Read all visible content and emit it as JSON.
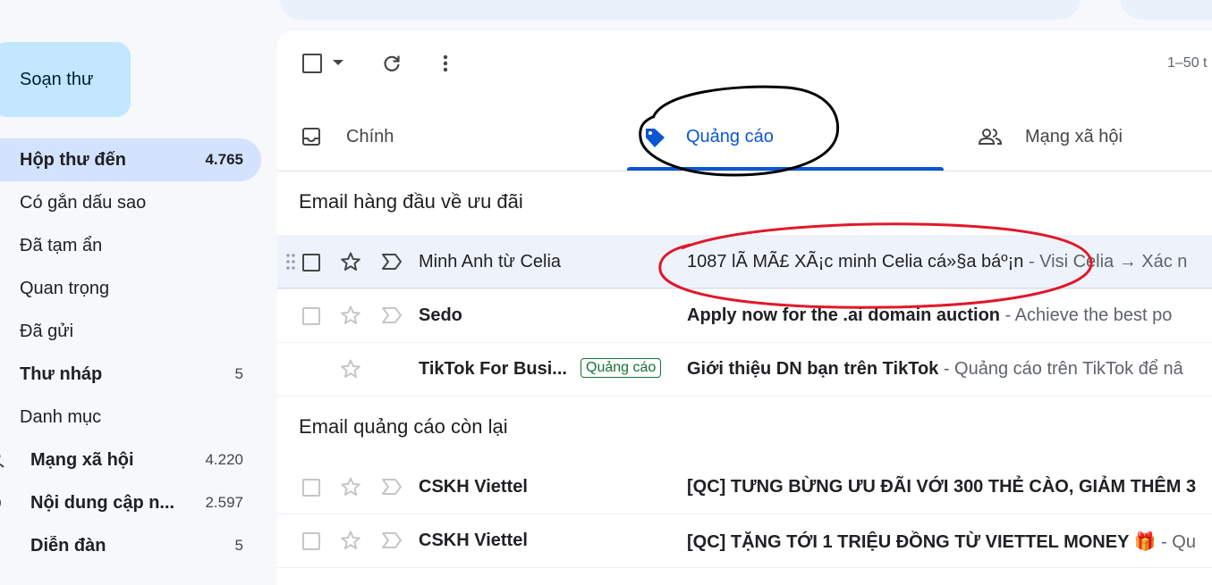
{
  "sidebar": {
    "compose_label": "Soạn thư",
    "items": [
      {
        "label": "Hộp thư đến",
        "count": "4.765"
      },
      {
        "label": "Có gắn dấu sao",
        "count": ""
      },
      {
        "label": "Đã tạm ẩn",
        "count": ""
      },
      {
        "label": "Quan trọng",
        "count": ""
      },
      {
        "label": "Đã gửi",
        "count": ""
      },
      {
        "label": "Thư nháp",
        "count": "5"
      },
      {
        "label": "Danh mục",
        "count": ""
      },
      {
        "label": "Mạng xã hội",
        "count": "4.220"
      },
      {
        "label": "Nội dung cập n...",
        "count": "2.597"
      },
      {
        "label": "Diễn đàn",
        "count": "5"
      }
    ]
  },
  "toolbar": {
    "pagination": "1–50 t",
    "icons": [
      "checkbox-icon",
      "chevron-down-icon",
      "refresh-icon",
      "more-vert-icon"
    ]
  },
  "tabs": [
    {
      "label": "Chính",
      "icon": "inbox-icon"
    },
    {
      "label": "Quảng cáo",
      "icon": "tag-icon"
    },
    {
      "label": "Mạng xã hội",
      "icon": "people-icon"
    }
  ],
  "sections": {
    "top_deals": "Email hàng đầu về ưu đãi",
    "remaining": "Email quảng cáo còn lại"
  },
  "emails": [
    {
      "sender": "Minh Anh từ Celia",
      "tag": "",
      "subject": "1087 lÃ  MÃ£ XÃ¡c minh Celia cá»§a báº¡n",
      "snippet": " - Visi Celia → Xác n"
    },
    {
      "sender": "Sedo",
      "tag": "",
      "subject": "Apply now for the .ai domain auction",
      "snippet": " - Achieve the best po"
    },
    {
      "sender": "TikTok For Busi...",
      "tag": "Quảng cáo",
      "subject": "Giới thiệu DN bạn trên TikTok",
      "snippet": " - Quảng cáo trên TikTok để nâ"
    },
    {
      "sender": "CSKH Viettel",
      "tag": "",
      "subject": "[QC] TƯNG BỪNG ƯU ĐÃI VỚI 300 THẺ CÀO, GIẢM THÊM 3",
      "snippet": ""
    },
    {
      "sender": "CSKH Viettel",
      "tag": "",
      "subject": "[QC] TẶNG TỚI 1 TRIỆU ĐỒNG TỪ VIETTEL MONEY 🎁",
      "snippet": " - Qu"
    }
  ],
  "colors": {
    "accent": "#0b57d0",
    "compose_bg": "#c2e7ff",
    "active_nav_bg": "#d3e3fd",
    "annotation_black": "#000000",
    "annotation_red": "#e0182a",
    "tag_green": "#137333"
  }
}
